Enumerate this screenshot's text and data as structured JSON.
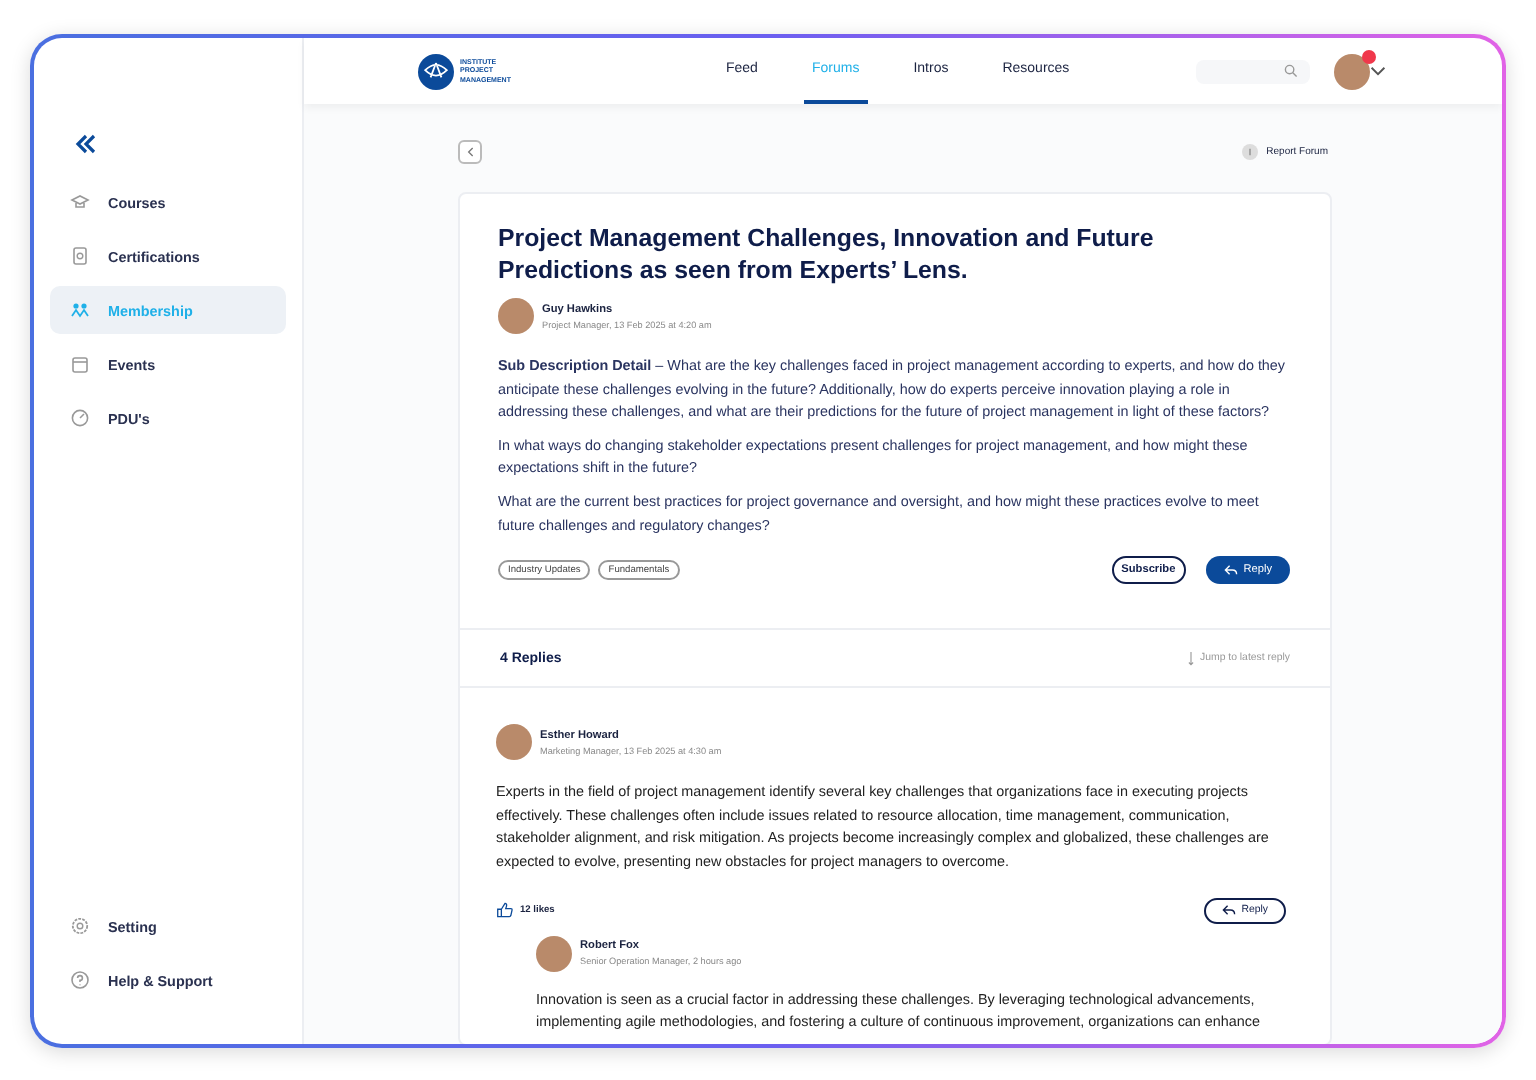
{
  "logo": {
    "text": "INSTITUTE PROJECT MANAGEMENT"
  },
  "nav": [
    {
      "label": "Feed",
      "selected": false
    },
    {
      "label": "Forums",
      "selected": true
    },
    {
      "label": "Intros",
      "selected": false
    },
    {
      "label": "Resources",
      "selected": false
    }
  ],
  "sidebar": {
    "items": [
      {
        "label": "Courses",
        "kind": "cap",
        "selected": false
      },
      {
        "label": "Certifications",
        "kind": "cert",
        "selected": false
      },
      {
        "label": "Membership",
        "kind": "people",
        "selected": true
      },
      {
        "label": "Events",
        "kind": "calendar",
        "selected": false
      },
      {
        "label": "PDU's",
        "kind": "gauge",
        "selected": false
      }
    ],
    "bottom_items": [
      {
        "label": "Setting",
        "kind": "gear",
        "selected": false
      },
      {
        "label": "Help & Support",
        "kind": "help",
        "selected": false
      }
    ]
  },
  "report": "Report Forum",
  "post": {
    "title": "Project Management Challenges, Innovation and Future Predictions as seen from Experts’ Lens.",
    "author": "Guy Hawkins",
    "role": "Project Manager,",
    "time": "13 Feb 2025 at 4:20 am",
    "paragraphs": [
      "**Sub Description Detail** – What are the key challenges faced in project management according to experts, and how do they anticipate these challenges evolving in the future? Additionally, how do experts perceive innovation playing a role in addressing these challenges, and what are their predictions for the future of project management in light of these factors?",
      "In what ways do changing stakeholder expectations present challenges for project management, and how might these expectations shift in the future?",
      "What are the current best practices for project governance and oversight, and how might these practices evolve to meet future challenges and regulatory changes?"
    ],
    "tags": [
      "Industry Updates",
      "Fundamentals"
    ],
    "subscribe": "Subscribe",
    "reply": "Reply"
  },
  "replies_header": {
    "count": "4 Replies",
    "jump": "Jump to latest reply"
  },
  "replies": [
    {
      "author": "Esther Howard",
      "role": "Marketing Manager,",
      "time": "13 Feb 2025 at 4:30 am",
      "text": "Experts in the field of project management identify several key challenges that organizations face in executing projects effectively. These challenges often include issues related to resource allocation, time management, communication, stakeholder alignment, and risk mitigation. As projects become increasingly complex and globalized, these challenges are expected to evolve, presenting new obstacles for project managers to overcome.",
      "likes": "12 likes",
      "reply": "Reply",
      "children": [
        {
          "author": "Robert Fox",
          "role": "Senior Operation Manager,",
          "time": "2 hours ago",
          "text": "Innovation is seen as a crucial factor in addressing these challenges. By leveraging technological advancements, implementing agile methodologies, and fostering a culture of continuous improvement, organizations can enhance"
        }
      ]
    }
  ]
}
